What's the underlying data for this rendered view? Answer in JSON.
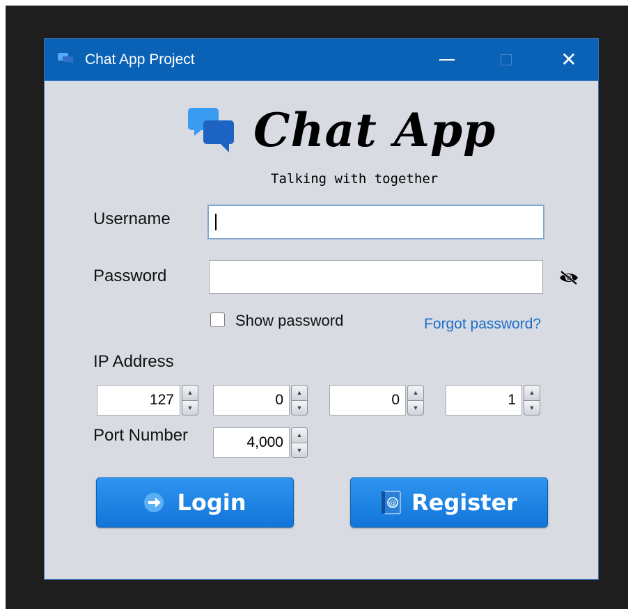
{
  "window": {
    "title": "Chat App Project",
    "minimize_label": "—",
    "maximize_label": "",
    "close_label": "✕"
  },
  "header": {
    "app_title": "Chat App",
    "subtitle": "Talking with together"
  },
  "form": {
    "username_label": "Username",
    "username_value": "",
    "password_label": "Password",
    "password_value": "",
    "show_password_label": "Show password",
    "show_password_checked": false,
    "forgot_password_label": "Forgot password?",
    "ip_label": "IP Address",
    "ip_octets": [
      "127",
      "0",
      "0",
      "1"
    ],
    "port_label": "Port Number",
    "port_value": "4,000"
  },
  "buttons": {
    "login_label": "Login",
    "register_label": "Register"
  },
  "colors": {
    "titlebar": "#0a62b7",
    "button": "#1e87e8",
    "link": "#1b6ec8",
    "window_bg": "#d9dbe3"
  },
  "icons": {
    "app": "chat-bubbles-icon",
    "eye": "eye-hidden-icon",
    "login": "arrow-right-icon",
    "register": "address-book-icon"
  }
}
